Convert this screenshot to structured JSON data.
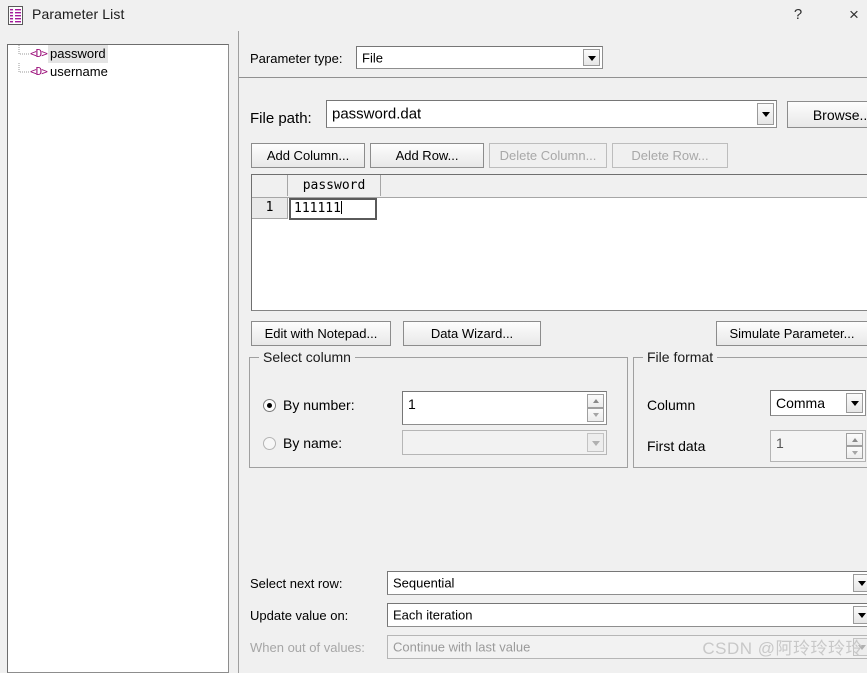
{
  "window": {
    "title": "Parameter List",
    "icon": "parameter-list-icon",
    "help_label": "?",
    "close_label": "×"
  },
  "tree": {
    "items": [
      {
        "label": "password",
        "icon": "<D>",
        "selected": true
      },
      {
        "label": "username",
        "icon": "<D>",
        "selected": false
      }
    ]
  },
  "parameter_type": {
    "label": "Parameter type:",
    "value": "File"
  },
  "file_path": {
    "label": "File path:",
    "value": "password.dat",
    "browse_label": "Browse..."
  },
  "table_buttons": {
    "add_column": "Add Column...",
    "add_row": "Add Row...",
    "delete_column": "Delete Column...",
    "delete_row": "Delete Row..."
  },
  "grid": {
    "columns": [
      "password"
    ],
    "rows": [
      {
        "number": "1",
        "cells": [
          "111111"
        ]
      }
    ]
  },
  "action_buttons": {
    "edit_with_notepad": "Edit with Notepad...",
    "data_wizard": "Data Wizard...",
    "simulate_parameter": "Simulate Parameter..."
  },
  "select_column": {
    "title": "Select column",
    "by_number_label": "By number:",
    "by_number_value": "1",
    "by_number_selected": true,
    "by_name_label": "By name:",
    "by_name_value": "",
    "by_name_selected": false
  },
  "file_format": {
    "title": "File format",
    "column_label": "Column",
    "column_value": "Comma",
    "first_data_label": "First data",
    "first_data_value": "1"
  },
  "bottom": {
    "select_next_row_label": "Select next row:",
    "select_next_row_value": "Sequential",
    "update_value_on_label": "Update value on:",
    "update_value_on_value": "Each iteration",
    "when_out_of_values_label": "When out of values:",
    "when_out_of_values_value": "Continue with last value"
  },
  "watermark": "CSDN @阿玲玲玲玲",
  "colors": {
    "window_bg": "#f0f0f0",
    "field_bg": "#ffffff",
    "border": "#8e8e8e",
    "tree_icon": "#9b0f7a",
    "disabled_text": "#a8a8a8"
  }
}
